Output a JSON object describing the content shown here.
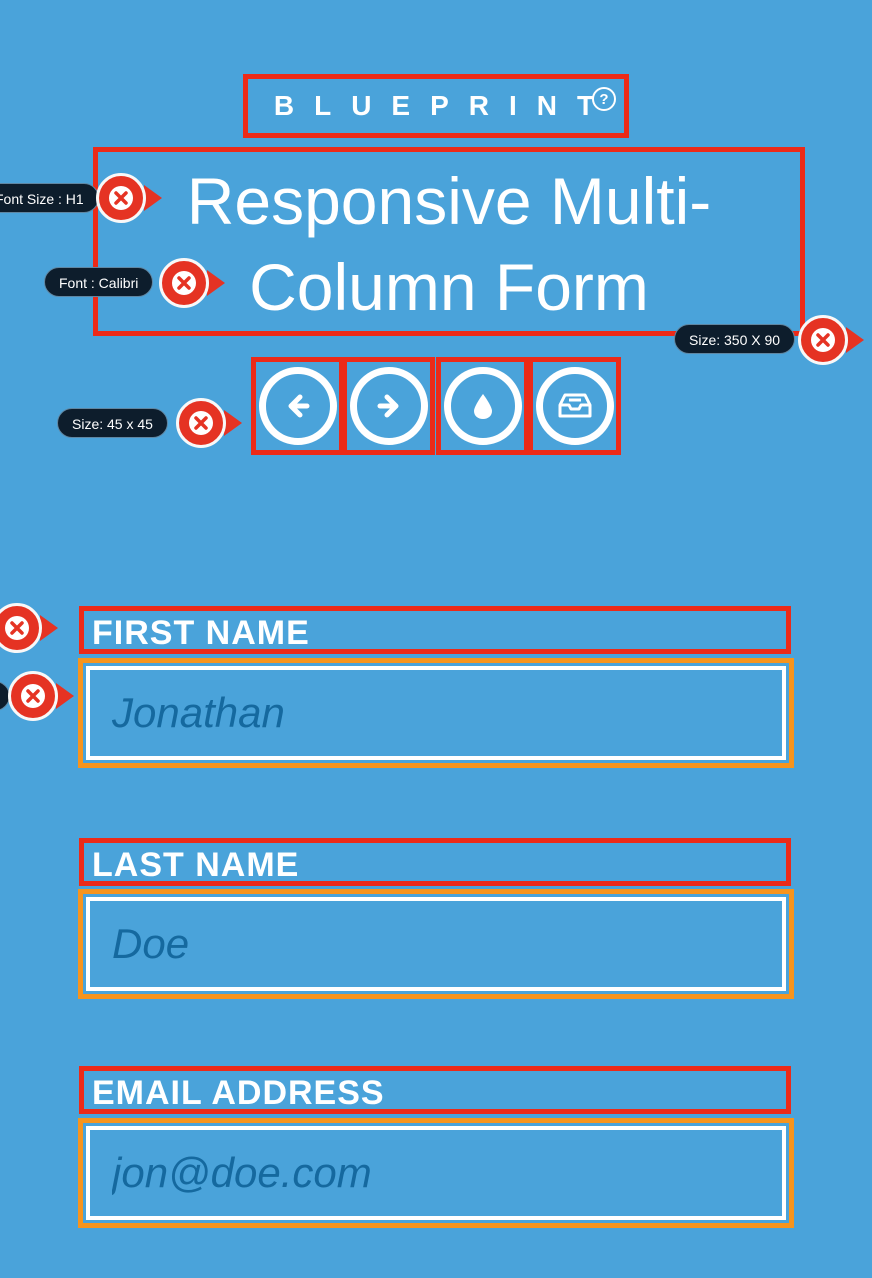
{
  "brand": {
    "name": "BLUEPRINT",
    "help_icon": "question-circle-icon",
    "help_glyph": "?"
  },
  "page_title": "Responsive Multi-Column Form",
  "toolbar": {
    "icons": [
      "arrow-left-icon",
      "arrow-right-icon",
      "droplet-icon",
      "inbox-icon"
    ]
  },
  "annotations": {
    "font_size": "Font Size : H1",
    "font": "Font : Calibri",
    "title_size": "Size: 350 X 90",
    "icon_size": "Size:  45 x 45"
  },
  "form": {
    "first_name": {
      "label": "FIRST NAME",
      "placeholder": "Jonathan",
      "value": ""
    },
    "last_name": {
      "label": "LAST NAME",
      "placeholder": "Doe",
      "value": ""
    },
    "email": {
      "label": "EMAIL ADDRESS",
      "placeholder": "jon@doe.com",
      "value": ""
    }
  },
  "colors": {
    "background": "#4aa3da",
    "annotation_red": "#ec2a18",
    "field_orange": "#f7941d",
    "placeholder_blue": "#15699f"
  }
}
